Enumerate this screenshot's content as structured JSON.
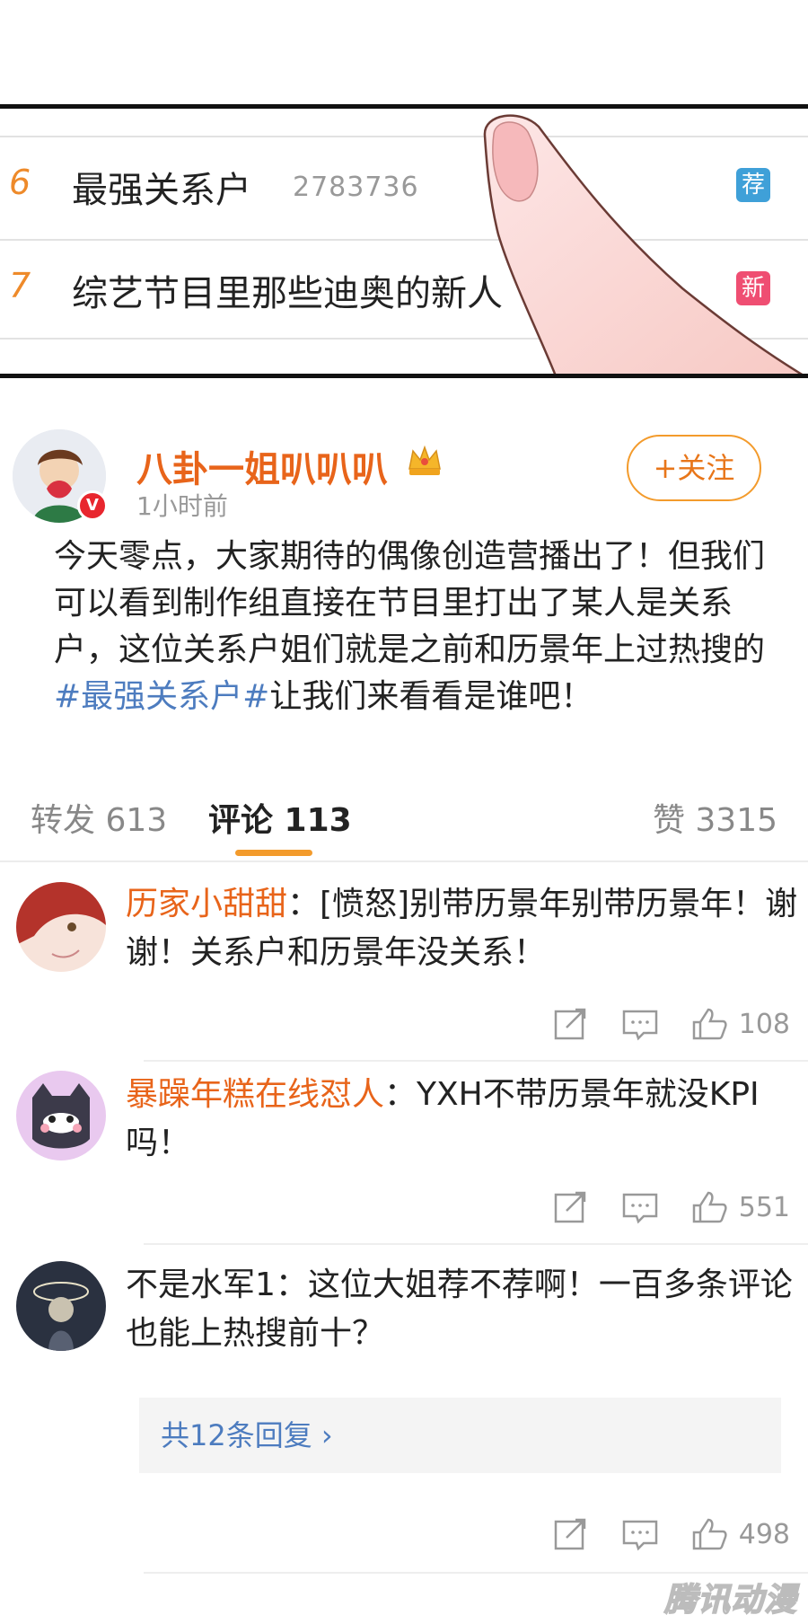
{
  "trending": {
    "items": [
      {
        "rank": "6",
        "title": "最强关系户",
        "count": "2783736",
        "badge": "荐"
      },
      {
        "rank": "7",
        "title": "综艺节目里那些迪奥的新人",
        "count": "",
        "badge": "新"
      }
    ]
  },
  "post": {
    "author": "八卦一姐叭叭叭",
    "time": "1小时前",
    "follow_label": "+关注",
    "verified_mark": "V",
    "body_before": "今天零点，大家期待的偶像创造营播出了！但我们可以看到制作组直接在节目里打出了某人是关系户，这位关系户姐们就是之前和历景年上过热搜的",
    "hashtag": "#最强关系户#",
    "body_after": "让我们来看看是谁吧！"
  },
  "tabs": {
    "repost": "转发 613",
    "comments": "评论 113",
    "likes": "赞 3315"
  },
  "comments": [
    {
      "name": "历家小甜甜",
      "text": "：[愤怒]别带历景年别带历景年！谢谢！关系户和历景年没关系！",
      "likes": "108"
    },
    {
      "name": "暴躁年糕在线怼人",
      "text": "：YXH不带历景年就没KPI吗！",
      "likes": "551"
    },
    {
      "name": "不是水军1",
      "text": "：这位大姐荐不荐啊！一百多条评论也能上热搜前十？",
      "likes": "498",
      "replies": "共12条回复 ›"
    }
  ],
  "watermark": "腾讯动漫",
  "colors": {
    "accent_orange": "#e8641a",
    "link_blue": "#4d7cbf",
    "rank_orange": "#ee8a2a",
    "badge_recommend": "#3fa0d8",
    "badge_new": "#ef4e72"
  }
}
